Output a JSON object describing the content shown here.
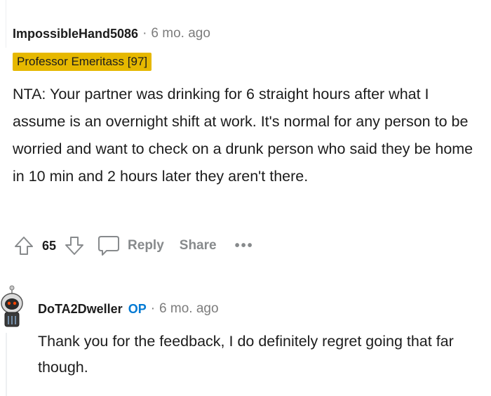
{
  "comment": {
    "author": "ImpossibleHand5086",
    "separator": "·",
    "time": "6 mo. ago",
    "flair": "Professor Emeritass [97]",
    "body": "NTA: Your partner was drinking for 6 straight hours after what I assume is an overnight shift at work. It's normal for any person to be worried and want to check on a drunk person who said they be home in 10 min and 2 hours later they aren't there.",
    "score": "65",
    "reply_label": "Reply",
    "share_label": "Share",
    "more_label": "•••"
  },
  "reply": {
    "author": "DoTA2Dweller",
    "op_badge": "OP",
    "separator": "·",
    "time": "6 mo. ago",
    "body": "Thank you for the feedback, I do definitely regret going that far though."
  },
  "colors": {
    "flair_bg": "#e6b800",
    "op_badge": "#0079d3",
    "muted": "#878a8c",
    "text": "#1c1c1c"
  },
  "icons": {
    "upvote": "upvote-arrow-icon",
    "downvote": "downvote-arrow-icon",
    "reply": "speech-bubble-icon",
    "avatar": "snoo-avatar-icon"
  }
}
